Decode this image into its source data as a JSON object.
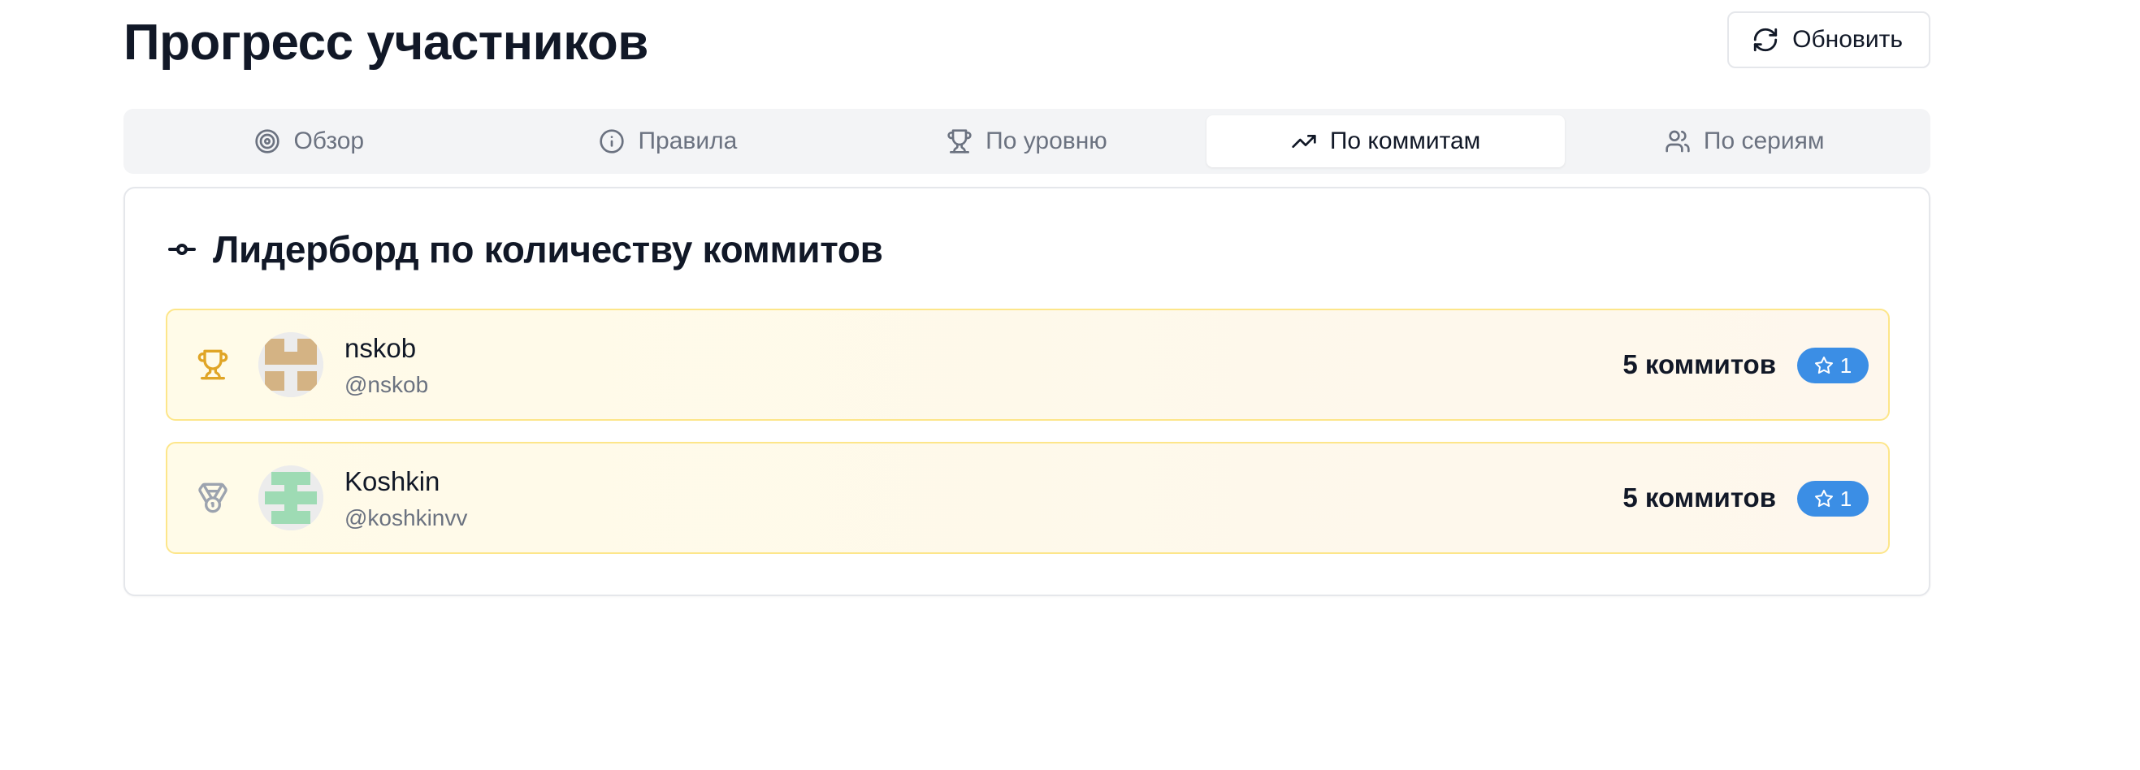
{
  "header": {
    "title": "Прогресс участников",
    "refresh_label": "Обновить"
  },
  "tabs": [
    {
      "label": "Обзор",
      "icon": "target-icon",
      "active": false
    },
    {
      "label": "Правила",
      "icon": "info-icon",
      "active": false
    },
    {
      "label": "По уровню",
      "icon": "trophy-icon",
      "active": false
    },
    {
      "label": "По коммитам",
      "icon": "trending-up-icon",
      "active": true
    },
    {
      "label": "По сериям",
      "icon": "users-icon",
      "active": false
    }
  ],
  "leaderboard": {
    "title": "Лидерборд по количеству коммитов",
    "title_icon": "git-commit-icon",
    "rows": [
      {
        "rank_icon": "trophy-icon",
        "name": "nskob",
        "handle": "@nskob",
        "commits": "5 коммитов",
        "stars": "1",
        "avatar_color": "#d4b384"
      },
      {
        "rank_icon": "medal-icon",
        "name": "Koshkin",
        "handle": "@koshkinvv",
        "commits": "5 коммитов",
        "stars": "1",
        "avatar_color": "#9edbb4"
      }
    ]
  },
  "colors": {
    "accent_badge": "#3b8ee5",
    "row_border": "#fde68a",
    "trophy_gold": "#e0a526",
    "medal_gray": "#9ca3af"
  }
}
